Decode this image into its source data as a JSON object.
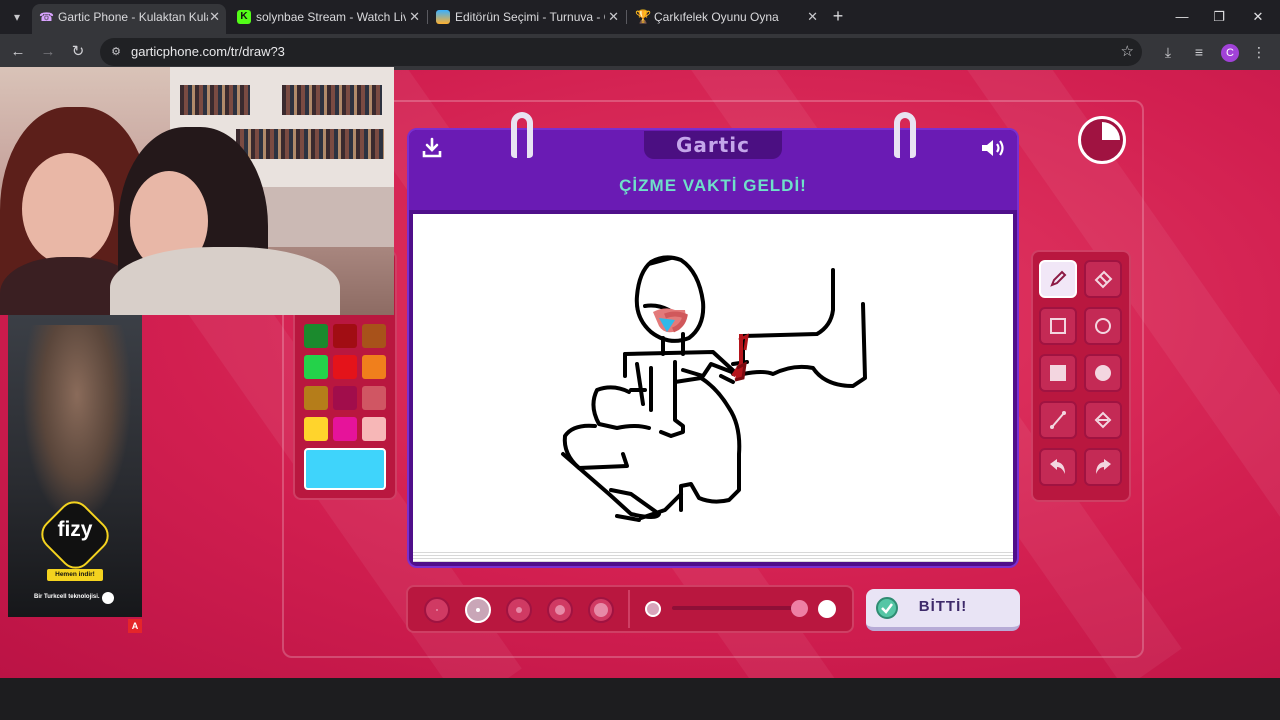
{
  "tabs": [
    {
      "label": "Gartic Phone - Kulaktan Kulağa",
      "icon": "phone-icon",
      "active": true
    },
    {
      "label": "solynbae Stream - Watch Live o",
      "icon": "kick-icon",
      "active": false
    },
    {
      "label": "Editörün Seçimi - Turnuva - Qu",
      "icon": "quiz-icon",
      "active": false
    },
    {
      "label": "Çarkıfelek Oyunu Oyna",
      "icon": "trophy-icon",
      "active": false
    }
  ],
  "browser": {
    "url": "garticphone.com/tr/draw?3",
    "profile_initial": "C"
  },
  "game": {
    "logo": "Gartic",
    "title": "ÇİZME VAKTİ GELDİ!",
    "done_label": "BİTTİ!",
    "timer_elapsed_fraction": 0.25,
    "selected_tool": "pen",
    "selected_size_index": 1,
    "opacity_value": 1.0,
    "palette": [
      "#1b8a2d",
      "#a10d13",
      "#a8521a",
      "#24d24a",
      "#e4131a",
      "#f07f1c",
      "#b57d1a",
      "#a10d4b",
      "#d05663",
      "#ffd42c",
      "#e6139a",
      "#f7b7b7"
    ],
    "selected_color": "#3fd4fb"
  },
  "ad": {
    "brand": "fizy",
    "cta": "Hemen indir!",
    "footer": "Bir Turkcell teknolojisi.",
    "badge": "A"
  }
}
